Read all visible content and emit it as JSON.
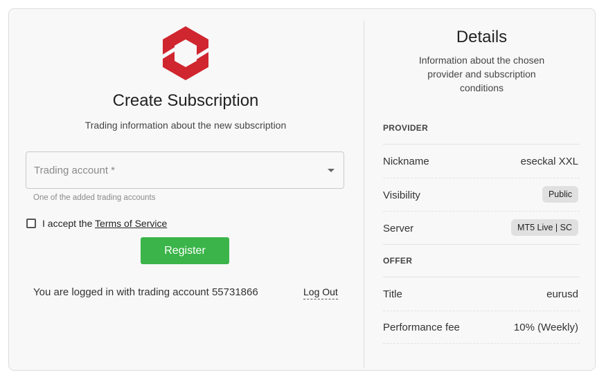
{
  "form": {
    "title": "Create Subscription",
    "subtitle": "Trading information about the new subscription",
    "trading_account_placeholder": "Trading account *",
    "trading_account_helper": "One of the added trading accounts",
    "accept_prefix": "I accept the",
    "terms_link": "Terms of Service",
    "register_label": "Register",
    "logged_in_text": "You are logged in with trading account 55731866",
    "logout_label": "Log Out"
  },
  "details": {
    "title": "Details",
    "subtitle": "Information about the chosen provider and subscription conditions",
    "provider_section": "PROVIDER",
    "provider_rows": [
      {
        "label": "Nickname",
        "value": "eseckal XXL"
      },
      {
        "label": "Visibility",
        "value": "Public"
      },
      {
        "label": "Server",
        "value": "MT5 Live | SC"
      }
    ],
    "offer_section": "OFFER",
    "offer_rows": [
      {
        "label": "Title",
        "value": "eurusd"
      },
      {
        "label": "Performance fee",
        "value": "10% (Weekly)"
      }
    ]
  },
  "icons": {
    "logo": "hexagon-logo-icon",
    "dropdown": "chevron-down-icon",
    "checkbox": "checkbox-icon"
  },
  "colors": {
    "brand": "#d0262f",
    "register": "#3bb54a",
    "chip": "#e0e0e0"
  }
}
